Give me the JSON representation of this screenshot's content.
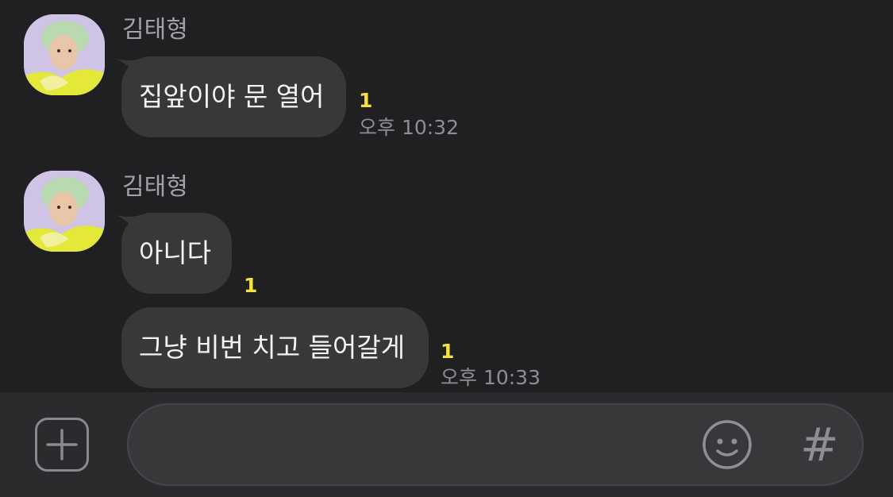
{
  "chat": {
    "groups": [
      {
        "sender": "김태형",
        "messages": [
          {
            "text": "집앞이야 문 열어",
            "unread": "1",
            "time": "오후 10:32"
          }
        ]
      },
      {
        "sender": "김태형",
        "messages": [
          {
            "text": "아니다",
            "unread": "1",
            "time": ""
          },
          {
            "text": "그냥 비번 치고 들어갈게",
            "unread": "1",
            "time": "오후 10:33"
          }
        ]
      }
    ]
  },
  "input_bar": {
    "plus_icon": "plus-square-icon",
    "emoji_icon": "smiley-icon",
    "hashtag_label": "#",
    "message_value": ""
  },
  "colors": {
    "background": "#202022",
    "bubble": "#38383b",
    "unread": "#f6e13b",
    "sender": "#a3a3a7",
    "time": "#8f8f93"
  }
}
